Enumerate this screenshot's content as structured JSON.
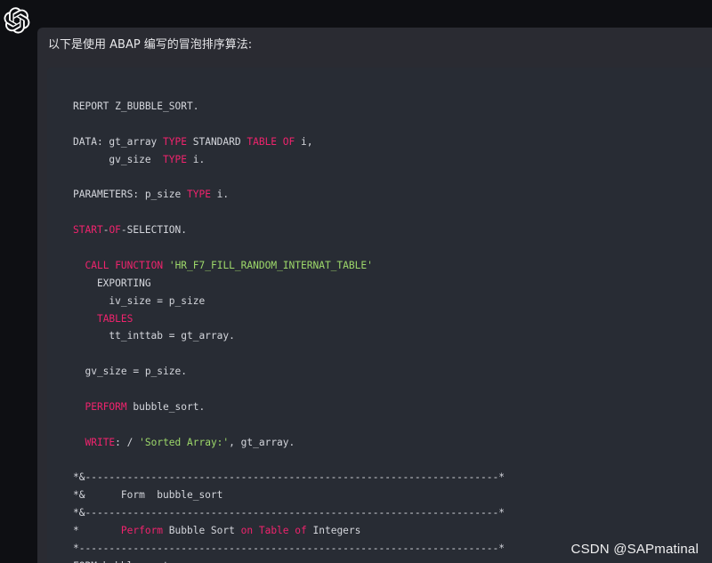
{
  "assistant": {
    "avatar_icon": "openai-logo-icon"
  },
  "message": {
    "intro": "以下是使用 ABAP 编写的冒泡排序算法:"
  },
  "code": {
    "language": "ABAP",
    "lines": [
      [
        {
          "t": "REPORT Z_BUBBLE_SORT.",
          "c": ""
        }
      ],
      [],
      [
        {
          "t": "DATA: gt_array ",
          "c": ""
        },
        {
          "t": "TYPE",
          "c": "kw"
        },
        {
          "t": " STANDARD ",
          "c": ""
        },
        {
          "t": "TABLE",
          "c": "kw"
        },
        {
          "t": " ",
          "c": ""
        },
        {
          "t": "OF",
          "c": "kw"
        },
        {
          "t": " i,",
          "c": ""
        }
      ],
      [
        {
          "t": "      gv_size  ",
          "c": ""
        },
        {
          "t": "TYPE",
          "c": "kw"
        },
        {
          "t": " i.",
          "c": ""
        }
      ],
      [],
      [
        {
          "t": "PARAMETERS: p_size ",
          "c": ""
        },
        {
          "t": "TYPE",
          "c": "kw"
        },
        {
          "t": " i.",
          "c": ""
        }
      ],
      [],
      [
        {
          "t": "START",
          "c": "kw"
        },
        {
          "t": "-",
          "c": ""
        },
        {
          "t": "OF",
          "c": "kw"
        },
        {
          "t": "-SELECTION.",
          "c": ""
        }
      ],
      [],
      [
        {
          "t": "  ",
          "c": ""
        },
        {
          "t": "CALL",
          "c": "kw"
        },
        {
          "t": " ",
          "c": ""
        },
        {
          "t": "FUNCTION",
          "c": "kw"
        },
        {
          "t": " ",
          "c": ""
        },
        {
          "t": "'HR_F7_FILL_RANDOM_INTERNAT_TABLE'",
          "c": "str"
        }
      ],
      [
        {
          "t": "    EXPORTING",
          "c": ""
        }
      ],
      [
        {
          "t": "      iv_size = p_size",
          "c": ""
        }
      ],
      [
        {
          "t": "    ",
          "c": ""
        },
        {
          "t": "TABLES",
          "c": "kw"
        }
      ],
      [
        {
          "t": "      tt_inttab = gt_array.",
          "c": ""
        }
      ],
      [],
      [
        {
          "t": "  gv_size = p_size.",
          "c": ""
        }
      ],
      [],
      [
        {
          "t": "  ",
          "c": ""
        },
        {
          "t": "PERFORM",
          "c": "kw"
        },
        {
          "t": " bubble_sort.",
          "c": ""
        }
      ],
      [],
      [
        {
          "t": "  ",
          "c": ""
        },
        {
          "t": "WRITE",
          "c": "kw"
        },
        {
          "t": ": / ",
          "c": ""
        },
        {
          "t": "'Sorted Array:'",
          "c": "str"
        },
        {
          "t": ", gt_array.",
          "c": ""
        }
      ],
      [],
      [
        {
          "t": "*&---------------------------------------------------------------------*",
          "c": "cm"
        }
      ],
      [
        {
          "t": "*&      Form  bubble_sort",
          "c": "cm"
        }
      ],
      [
        {
          "t": "*&---------------------------------------------------------------------*",
          "c": "cm"
        }
      ],
      [
        {
          "t": "*       ",
          "c": "cm"
        },
        {
          "t": "Perform",
          "c": "kw"
        },
        {
          "t": " Bubble Sort ",
          "c": "cm"
        },
        {
          "t": "on",
          "c": "kw"
        },
        {
          "t": " ",
          "c": "cm"
        },
        {
          "t": "Table",
          "c": "kw"
        },
        {
          "t": " ",
          "c": "cm"
        },
        {
          "t": "of",
          "c": "kw"
        },
        {
          "t": " Integers",
          "c": "cm"
        }
      ],
      [
        {
          "t": "*----------------------------------------------------------------------*",
          "c": "cm"
        }
      ],
      [
        {
          "t": "FORM bubble_sort.",
          "c": ""
        }
      ]
    ]
  },
  "watermark": "CSDN @SAPmatinal",
  "colors": {
    "keyword": "#f0236d",
    "string": "#9dd86a",
    "code_text": "#d4d6dc",
    "code_bg": "#282c34",
    "message_bg": "#2a2b32",
    "page_bg": "#0e0f13"
  }
}
